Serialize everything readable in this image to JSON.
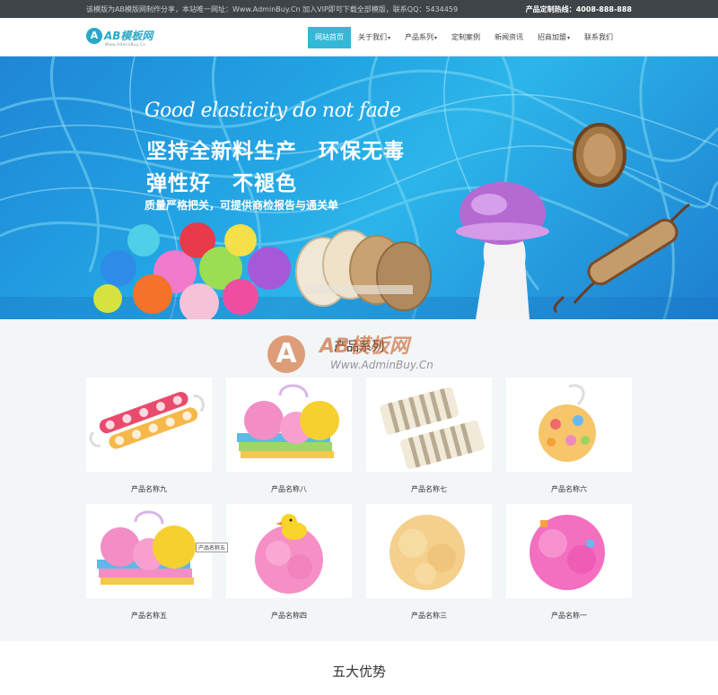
{
  "topbar": {
    "notice": "该模版为AB模版网制作分享，本站唯一网址：Www.AdminBuy.Cn 加入VIP即可下载全部模版，联系QQ：5434459",
    "hotline_label": "产品定制热线：",
    "hotline_number": "4008-888-888"
  },
  "logo": {
    "badge": "A",
    "text": "AB模板网",
    "sub": "Www.AdminBuy.Cn"
  },
  "nav": {
    "items": [
      {
        "label": "网站首页",
        "active": true
      },
      {
        "label": "关于我们",
        "caret": "▾"
      },
      {
        "label": "产品系列",
        "caret": "▾"
      },
      {
        "label": "定制案例"
      },
      {
        "label": "新闻资讯"
      },
      {
        "label": "招商加盟",
        "caret": "▾"
      },
      {
        "label": "联系我们"
      }
    ]
  },
  "banner": {
    "en": "Good elasticity do not fade",
    "line1": "坚持全新料生产　环保无毒",
    "line2": "弹性好　不褪色",
    "line3": "质量严格把关，可提供商检报告与通关单"
  },
  "watermark": {
    "letter": "A",
    "text": "AB模板网",
    "sub": "Www.AdminBuy.Cn"
  },
  "products": {
    "title": "产品系列",
    "items": [
      {
        "name": "产品名称九",
        "icon": "bath-strap-icon"
      },
      {
        "name": "产品名称八",
        "icon": "bath-sponge-set-icon"
      },
      {
        "name": "产品名称七",
        "icon": "bath-towel-icon"
      },
      {
        "name": "产品名称六",
        "icon": "bath-ball-icon"
      },
      {
        "name": "产品名称五",
        "icon": "bath-sponge-set-icon"
      },
      {
        "name": "产品名称四",
        "icon": "duck-puff-icon"
      },
      {
        "name": "产品名称三",
        "icon": "bath-puff-icon"
      },
      {
        "name": "产品名称一",
        "icon": "bath-puff-icon"
      }
    ],
    "tooltip": "产品名称五"
  },
  "advantages": {
    "title": "五大优势"
  },
  "colors": {
    "accent": "#35b7d6",
    "topbar_bg": "#3f4448",
    "section_bg": "#f2f6f6"
  }
}
